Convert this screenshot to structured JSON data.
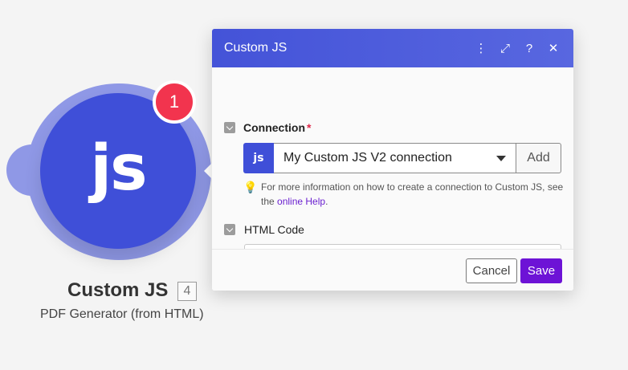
{
  "module": {
    "logo_text": "js",
    "badge_count": "1",
    "title": "Custom JS",
    "id": "4",
    "subtitle": "PDF Generator (from HTML)"
  },
  "dialog": {
    "title": "Custom JS",
    "header_icons": [
      "more-vertical-icon",
      "expand-icon",
      "help-icon",
      "close-icon"
    ],
    "header_glyphs": {
      "more": "⋮",
      "expand": "⤢",
      "help": "?",
      "close": "✕"
    },
    "connection": {
      "label": "Connection",
      "required_mark": "*",
      "icon_text": "js",
      "selected_value": "My Custom JS V2 connection",
      "add_label": "Add",
      "hint_prefix": "For more information on how to create a connection to Custom JS, see the ",
      "hint_link": "online Help",
      "hint_suffix": "."
    },
    "html_code": {
      "label": "HTML Code",
      "value": ""
    },
    "footer": {
      "cancel_label": "Cancel",
      "save_label": "Save"
    }
  },
  "colors": {
    "accent": "#4453d8",
    "node": "#3f4fd8",
    "node_ring": "#8f98e6",
    "badge": "#f2344e",
    "save": "#6d13d6"
  }
}
